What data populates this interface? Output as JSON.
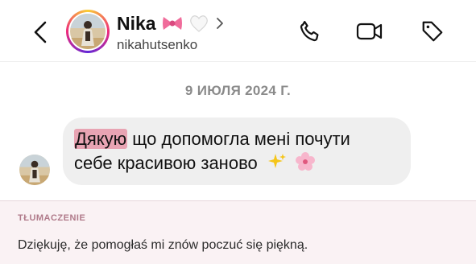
{
  "header": {
    "name": "Nika",
    "username": "nikahutsenko",
    "icons": [
      "back-chevron-icon",
      "bow-icon",
      "white-heart-icon",
      "chevron-right-icon",
      "phone-icon",
      "video-camera-icon",
      "tag-icon"
    ]
  },
  "chat": {
    "date": "9 ИЮЛЯ 2024 Г.",
    "message": {
      "highlighted_word": "Дякую",
      "line1_rest": " що допомогла мені почути",
      "line2": "себе красивою заново"
    }
  },
  "translation": {
    "label": "TŁUMACZENIE",
    "text": "Dziękuję, że pomogłaś mi znów poczuć się piękną."
  },
  "colors": {
    "highlight": "#e8a4b3",
    "bubble": "#efefef",
    "translation_bg": "#faf2f4",
    "translation_label": "#b07a8a"
  }
}
